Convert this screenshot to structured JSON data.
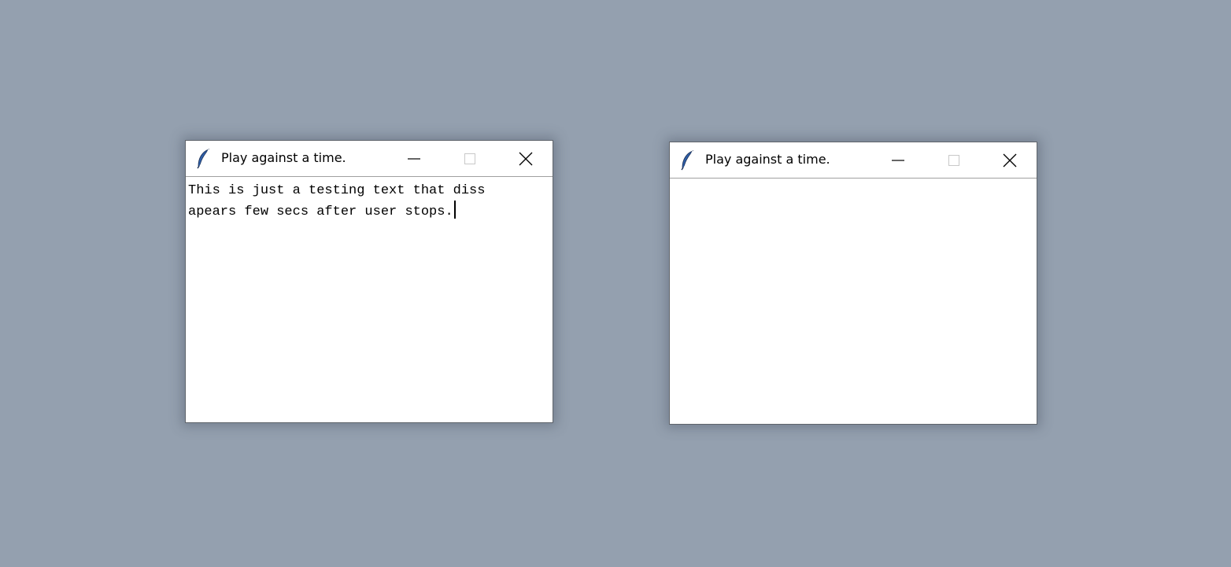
{
  "windows": [
    {
      "title": "Play against a time.",
      "icon": "feather-icon",
      "controls": [
        "minimize-icon",
        "maximize-icon",
        "close-icon"
      ],
      "text_lines": [
        "This is just a testing text that diss",
        "apears few secs after user stops."
      ]
    },
    {
      "title": "Play against a time.",
      "icon": "feather-icon",
      "controls": [
        "minimize-icon",
        "maximize-icon",
        "close-icon"
      ],
      "text_lines": []
    }
  ],
  "colors": {
    "desktop": "#94a0af",
    "window_bg": "#ffffff",
    "border": "#5f646b",
    "feather": "#2f5fa8"
  }
}
